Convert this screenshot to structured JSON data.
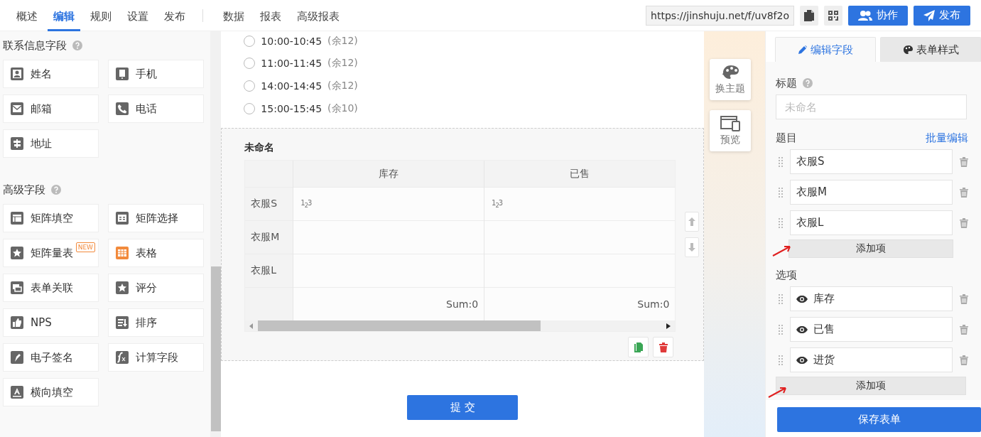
{
  "nav": {
    "tabs": [
      {
        "label": "概述",
        "selected": false
      },
      {
        "label": "编辑",
        "selected": true
      },
      {
        "label": "规则",
        "selected": false
      },
      {
        "label": "设置",
        "selected": false
      },
      {
        "label": "发布",
        "selected": false
      }
    ],
    "report_tabs": [
      {
        "label": "数据",
        "selected": false
      },
      {
        "label": "报表",
        "selected": false
      },
      {
        "label": "高级报表",
        "selected": false
      }
    ]
  },
  "share": {
    "url": "https://jinshuju.net/f/uv8f2o",
    "buttons": [
      {
        "label": "协作",
        "kind": "collab"
      },
      {
        "label": "发布",
        "kind": "publish"
      }
    ]
  },
  "field_panel": {
    "groups": [
      {
        "title": "联系信息字段",
        "items": [
          {
            "label": "姓名",
            "kind": "person"
          },
          {
            "label": "手机",
            "kind": "mobile"
          },
          {
            "label": "邮箱",
            "kind": "mail"
          },
          {
            "label": "电话",
            "kind": "phone"
          },
          {
            "label": "地址",
            "kind": "sign"
          }
        ]
      },
      {
        "title": "高级字段",
        "items": [
          {
            "label": "矩阵填空",
            "kind": "matrix"
          },
          {
            "label": "矩阵选择",
            "kind": "matrix-choice"
          },
          {
            "label": "矩阵量表",
            "kind": "scale",
            "badge": "NEW"
          },
          {
            "label": "表格",
            "kind": "table"
          },
          {
            "label": "表单关联",
            "kind": "link"
          },
          {
            "label": "评分",
            "kind": "star"
          },
          {
            "label": "NPS",
            "kind": "thumb"
          },
          {
            "label": "排序",
            "kind": "sort"
          },
          {
            "label": "电子签名",
            "kind": "pen"
          },
          {
            "label": "计算字段",
            "kind": "fx"
          },
          {
            "label": "横向填空",
            "kind": "letter"
          }
        ]
      }
    ]
  },
  "form": {
    "time_slots": [
      {
        "label": "10:00-10:45",
        "note": "(余12)",
        "selected": false
      },
      {
        "label": "11:00-11:45",
        "note": "(余12)",
        "selected": false
      },
      {
        "label": "14:00-14:45",
        "note": "(余12)",
        "selected": false
      },
      {
        "label": "15:00-15:45",
        "note": "(余10)",
        "selected": false
      }
    ],
    "matrix": {
      "title": "未命名",
      "columns": [
        {
          "label": "库存",
          "sum": "Sum:0"
        },
        {
          "label": "已售",
          "sum": "Sum:0"
        }
      ],
      "rows": [
        {
          "label": "衣服S",
          "cells": [
            "1$_{2}$3",
            "1$_{2}$3"
          ]
        },
        {
          "label": "衣服M"
        },
        {
          "label": "衣服L"
        }
      ]
    },
    "submit": "提 交"
  },
  "side_tools": [
    {
      "label": "换主题",
      "kind": "theme"
    },
    {
      "label": "预览",
      "kind": "preview"
    }
  ],
  "editor": {
    "tabs": [
      {
        "label": "编辑字段",
        "kind": "edit",
        "selected": true
      },
      {
        "label": "表单样式",
        "kind": "style",
        "selected": false
      }
    ],
    "title_label": "标题",
    "title_placeholder": "未命名",
    "questions_label": "题目",
    "batch_edit": "批量编辑",
    "questions": [
      "衣服S",
      "衣服M",
      "衣服L"
    ],
    "add_question": "添加项",
    "options_label": "选项",
    "options": [
      {
        "label": "库存",
        "visible": true
      },
      {
        "label": "已售",
        "visible": true
      },
      {
        "label": "进货",
        "visible": true
      }
    ],
    "add_option": "添加项",
    "save": "保存表单"
  }
}
